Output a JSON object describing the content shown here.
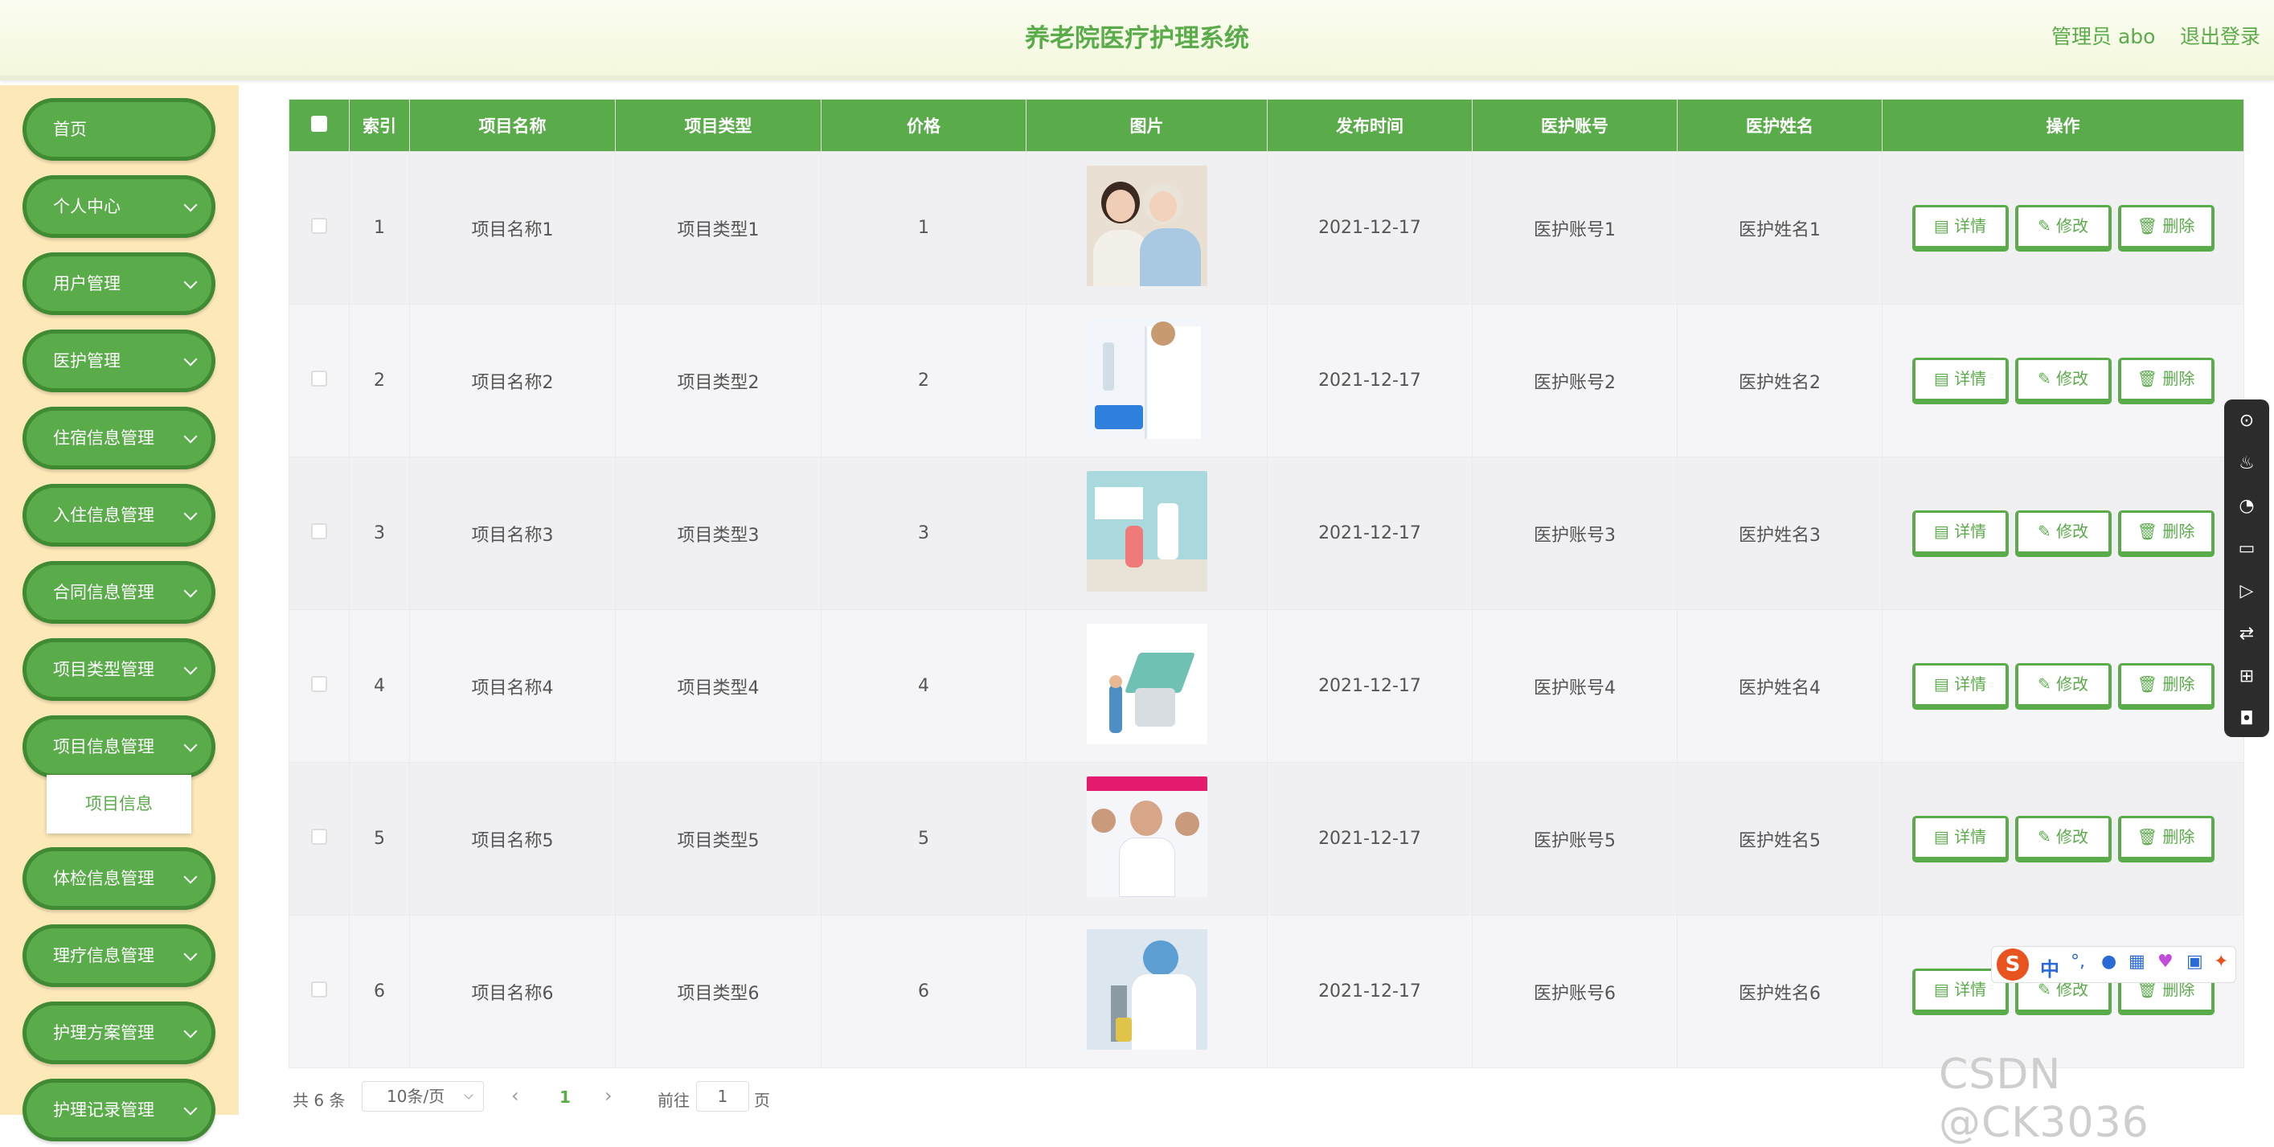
{
  "header": {
    "title": "养老院医疗护理系统",
    "user": "管理员 abo",
    "logout": "退出登录"
  },
  "sidebar": {
    "items": [
      {
        "label": "首页",
        "expandable": false
      },
      {
        "label": "个人中心",
        "expandable": true
      },
      {
        "label": "用户管理",
        "expandable": true
      },
      {
        "label": "医护管理",
        "expandable": true
      },
      {
        "label": "住宿信息管理",
        "expandable": true
      },
      {
        "label": "入住信息管理",
        "expandable": true
      },
      {
        "label": "合同信息管理",
        "expandable": true
      },
      {
        "label": "项目类型管理",
        "expandable": true
      },
      {
        "label": "项目信息管理",
        "expandable": true
      },
      {
        "label": "体检信息管理",
        "expandable": true
      },
      {
        "label": "理疗信息管理",
        "expandable": true
      },
      {
        "label": "护理方案管理",
        "expandable": true
      },
      {
        "label": "护理记录管理",
        "expandable": true
      }
    ],
    "submenu_label": "项目信息"
  },
  "table": {
    "headers": [
      "",
      "索引",
      "项目名称",
      "项目类型",
      "价格",
      "图片",
      "发布时间",
      "医护账号",
      "医护姓名",
      "操作"
    ],
    "rows": [
      {
        "index": "1",
        "name": "项目名称1",
        "type": "项目类型1",
        "price": "1",
        "time": "2021-12-17",
        "account": "医护账号1",
        "nurse": "医护姓名1"
      },
      {
        "index": "2",
        "name": "项目名称2",
        "type": "项目类型2",
        "price": "2",
        "time": "2021-12-17",
        "account": "医护账号2",
        "nurse": "医护姓名2"
      },
      {
        "index": "3",
        "name": "项目名称3",
        "type": "项目类型3",
        "price": "3",
        "time": "2021-12-17",
        "account": "医护账号3",
        "nurse": "医护姓名3"
      },
      {
        "index": "4",
        "name": "项目名称4",
        "type": "项目类型4",
        "price": "4",
        "time": "2021-12-17",
        "account": "医护账号4",
        "nurse": "医护姓名4"
      },
      {
        "index": "5",
        "name": "项目名称5",
        "type": "项目类型5",
        "price": "5",
        "time": "2021-12-17",
        "account": "医护账号5",
        "nurse": "医护姓名5"
      },
      {
        "index": "6",
        "name": "项目名称6",
        "type": "项目类型6",
        "price": "6",
        "time": "2021-12-17",
        "account": "医护账号6",
        "nurse": "医护姓名6"
      }
    ],
    "actions": {
      "detail": "详情",
      "edit": "修改",
      "delete": "删除"
    }
  },
  "pagination": {
    "total": "共 6 条",
    "page_size": "10条/页",
    "current_page": "1",
    "goto_label": "前往",
    "goto_value": "1",
    "page_suffix": "页"
  },
  "ime": {
    "label": "中"
  },
  "watermark": "CSDN @CK3036",
  "colors": {
    "primary": "#5aab4a",
    "sidebar_bg": "#fde9b8"
  }
}
